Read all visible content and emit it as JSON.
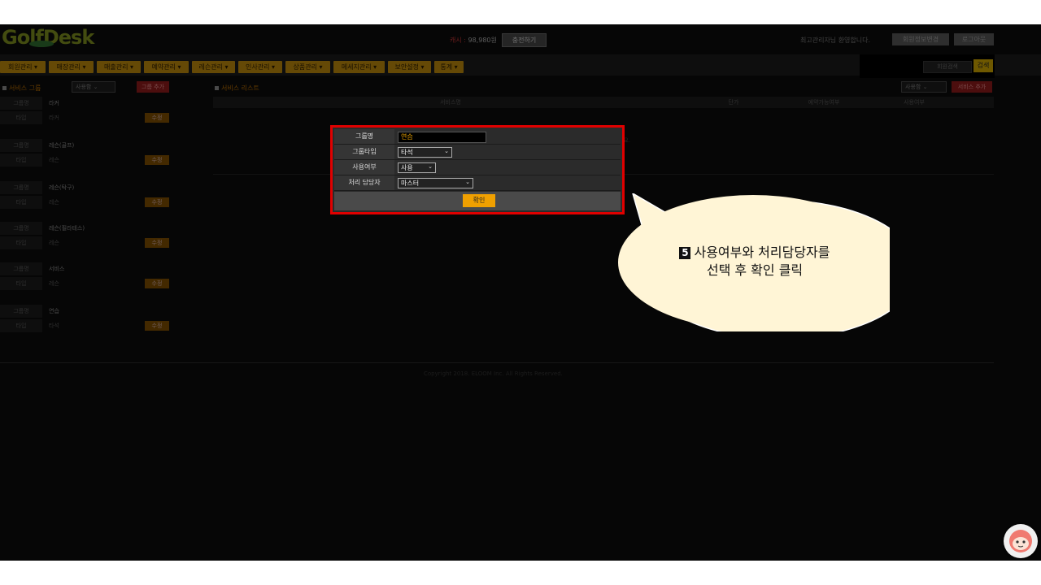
{
  "header": {
    "logo": "GolfDesk",
    "cash_label": "캐시 :",
    "cash_value": "98,980원",
    "charge_button": "충전하기",
    "welcome": "최고관리자님 환영합니다.",
    "buttons": [
      "회원정보변경",
      "로그아웃"
    ]
  },
  "nav": {
    "items": [
      "회원관리 ▾",
      "매장관리 ▾",
      "매출관리 ▾",
      "예약관리 ▾",
      "레슨관리 ▾",
      "인사관리 ▾",
      "상품관리 ▾",
      "메세지관리 ▾",
      "보안설정 ▾",
      "통계 ▾"
    ],
    "search_placeholder": "회원검색",
    "search_button": "검색"
  },
  "left": {
    "title": "서비스 그룹",
    "filter": "사용함",
    "add_button": "그룹 추가",
    "label_group": "그룹명",
    "label_type": "타입",
    "edit_button": "수정",
    "groups": [
      {
        "name": "라커",
        "type": "라커"
      },
      {
        "name": "레슨(골프)",
        "type": "레슨"
      },
      {
        "name": "레슨(탁구)",
        "type": "레슨"
      },
      {
        "name": "레슨(필라테스)",
        "type": "레슨"
      },
      {
        "name": "서비스",
        "type": "레슨"
      },
      {
        "name": "연습",
        "type": "타석"
      }
    ]
  },
  "right": {
    "title": "서비스 리스트",
    "filter": "사용함",
    "add_button": "서비스 추가",
    "columns": [
      "서비스명",
      "단가",
      "예약가능여부",
      "사용여부"
    ],
    "empty_message": "세요."
  },
  "footer": {
    "copyright": "Copyright 2018. ELOOM Inc. All Rights Reserved."
  },
  "modal": {
    "group_name_label": "그룹명",
    "group_name_value": "연습",
    "group_type_label": "그룹타입",
    "group_type_value": "타석",
    "usage_label": "사용여부",
    "usage_value": "사용",
    "manager_label": "처리 담당자",
    "manager_value": "마스터",
    "confirm": "확인"
  },
  "callout": {
    "step": "5",
    "line1": "사용여부와 처리담당자를",
    "line2": "선택 후 확인 클릭"
  },
  "colors": {
    "highlight": "#e00000",
    "callout_bg": "#fff5d6",
    "accent": "#f0a000"
  }
}
